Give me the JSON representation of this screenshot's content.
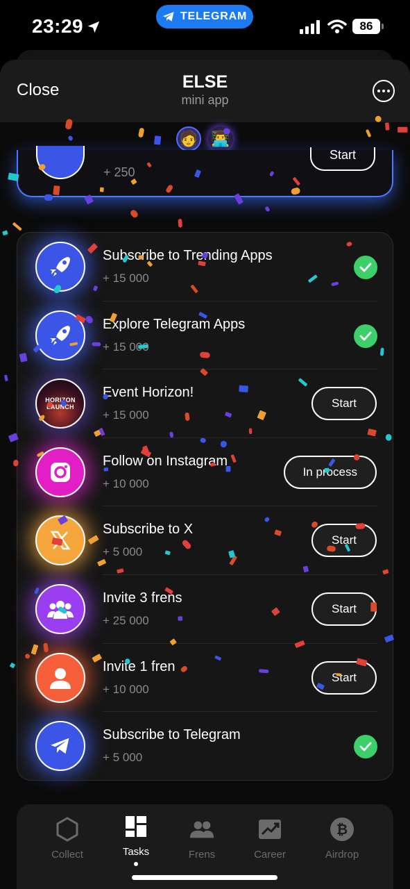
{
  "status_bar": {
    "time": "23:29",
    "telegram_pill": "TELEGRAM",
    "battery": "86"
  },
  "header": {
    "close_label": "Close",
    "title": "ELSE",
    "subtitle": "mini app"
  },
  "top_card": {
    "points": "+ 250",
    "button": "Start"
  },
  "tasks": [
    {
      "title": "Subscribe to Trending Apps",
      "points": "+ 15 000",
      "state": "done",
      "icon": "rocket-icon",
      "color": "#3b55e6"
    },
    {
      "title": "Explore Telegram Apps",
      "points": "+ 15 000",
      "state": "done",
      "icon": "rocket-icon",
      "color": "#3b55e6"
    },
    {
      "title": "Event Horizon!",
      "points": "+ 15 000",
      "state": "start",
      "button": "Start",
      "icon": "horizon-launch-icon",
      "icon_text": "HORIZON LAUNCH",
      "color": "#2a1230"
    },
    {
      "title": "Follow on Instagram",
      "points": "+ 10 000",
      "state": "process",
      "button": "In process",
      "icon": "instagram-icon",
      "color": "#e21fc4"
    },
    {
      "title": "Subscribe to X",
      "points": "+ 5 000",
      "state": "start",
      "button": "Start",
      "icon": "x-logo-icon",
      "color": "#f5a63c"
    },
    {
      "title": "Invite 3 frens",
      "points": "+ 25 000",
      "state": "start",
      "button": "Start",
      "icon": "group-icon",
      "color": "#9a3ff0"
    },
    {
      "title": "Invite 1 fren",
      "points": "+ 10 000",
      "state": "start",
      "button": "Start",
      "icon": "person-icon",
      "color": "#f5603a"
    },
    {
      "title": "Subscribe to Telegram",
      "points": "+ 5 000",
      "state": "done",
      "icon": "telegram-icon",
      "color": "#3b55e6"
    }
  ],
  "nav": [
    {
      "label": "Collect",
      "icon": "hexagon-icon",
      "active": false
    },
    {
      "label": "Tasks",
      "icon": "tasks-grid-icon",
      "active": true
    },
    {
      "label": "Frens",
      "icon": "frens-icon",
      "active": false
    },
    {
      "label": "Career",
      "icon": "career-chart-icon",
      "active": false
    },
    {
      "label": "Airdrop",
      "icon": "bitcoin-icon",
      "active": false
    }
  ],
  "colors": {
    "accent_green": "#3ccf6a",
    "accent_blue": "#1d7bf2",
    "sheet_bg": "#0b0b0b"
  }
}
